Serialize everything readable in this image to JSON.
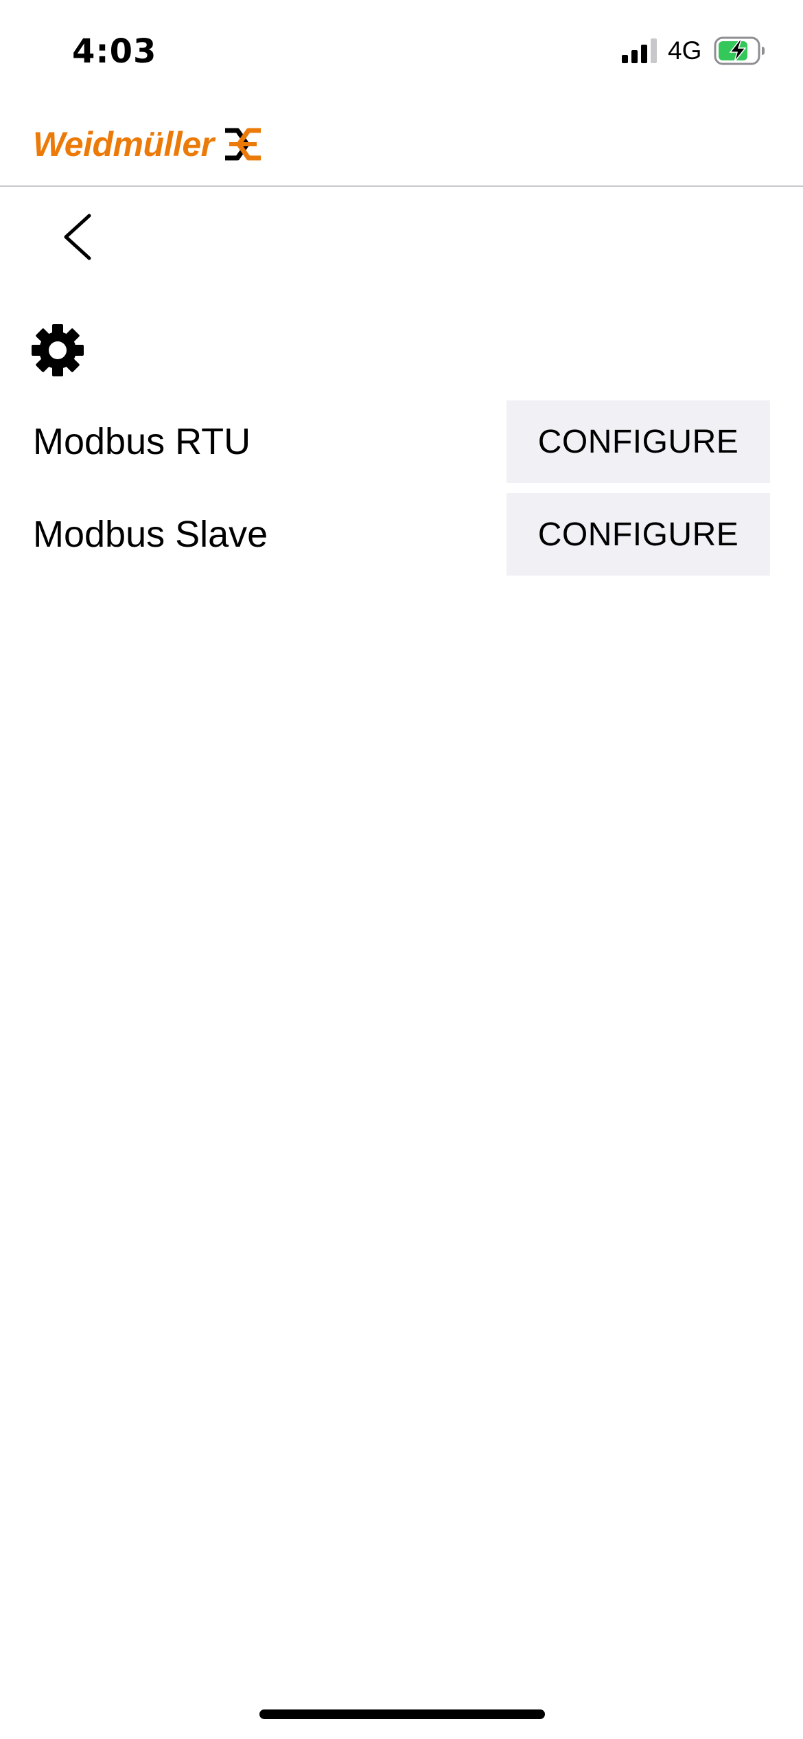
{
  "status_bar": {
    "time": "4:03",
    "network": "4G",
    "signal_icon": "cellular-signal-icon",
    "battery_icon": "battery-charging-icon",
    "battery_color": "#34c759"
  },
  "header": {
    "logo_text": "Weidmüller",
    "logo_color": "#ec7a08",
    "logo_mark_icon": "weidmuller-logo-mark-icon"
  },
  "nav": {
    "back_icon": "chevron-left-icon"
  },
  "section": {
    "icon": "gear-icon"
  },
  "rows": [
    {
      "label": "Modbus RTU",
      "button_label": "CONFIGURE"
    },
    {
      "label": "Modbus Slave",
      "button_label": "CONFIGURE"
    }
  ],
  "colors": {
    "button_background": "#f0f0f5",
    "divider": "#c8c8cc"
  }
}
